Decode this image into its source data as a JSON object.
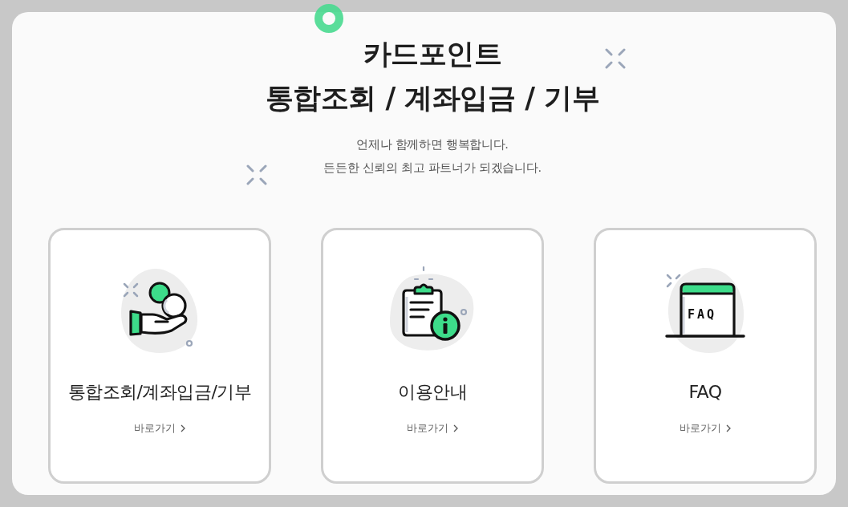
{
  "header": {
    "title_lines": [
      "카드포인트",
      "통합조회 / 계좌입금 / 기부"
    ],
    "subtitle_lines": [
      "언제나 함께하면 행복합니다.",
      "든든한 신뢰의 최고 파트너가 되겠습니다."
    ]
  },
  "cards": [
    {
      "kind": "coins",
      "title": "통합조회/계좌입금/기부",
      "link": "바로가기"
    },
    {
      "kind": "clipboard",
      "title": "이용안내",
      "link": "바로가기"
    },
    {
      "kind": "faq",
      "icon_text": "FAQ",
      "title": "FAQ",
      "link": "바로가기"
    }
  ]
}
